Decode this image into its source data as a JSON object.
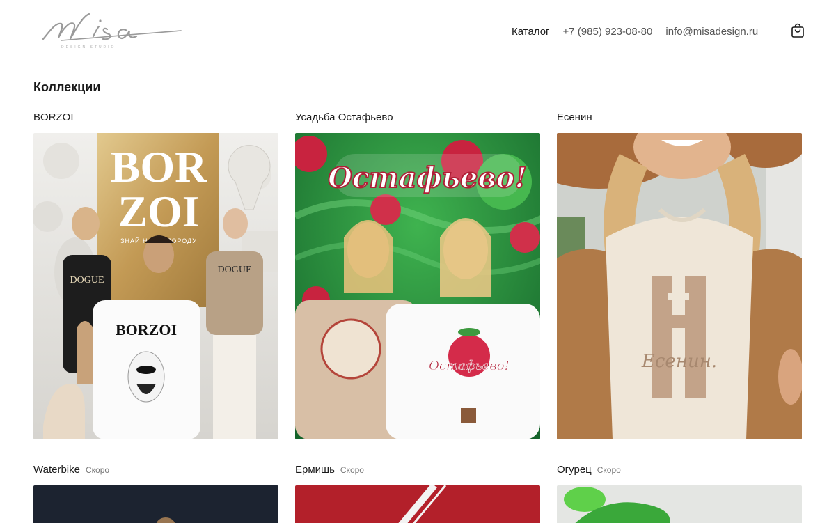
{
  "header": {
    "logo": {
      "text": "Misa",
      "subtext": "DESIGN STUDIO"
    },
    "nav": {
      "catalog": "Каталог",
      "phone": "+7 (985) 923-08-80",
      "email": "info@misadesign.ru"
    },
    "cart_icon": "shopping-bag-icon"
  },
  "main": {
    "title": "Коллекции",
    "collections": [
      {
        "name": "BORZOI",
        "badge": ""
      },
      {
        "name": "Усадьба Остафьево",
        "badge": ""
      },
      {
        "name": "Есенин",
        "badge": ""
      },
      {
        "name": "Waterbike",
        "badge": "Скоро"
      },
      {
        "name": "Ермишь",
        "badge": "Скоро"
      },
      {
        "name": "Огурец",
        "badge": "Скоро"
      }
    ]
  },
  "images": {
    "borzoi": {
      "headline": "BOR ZOI",
      "sub": "ЗНАЙ НАШУ ПОРОДУ",
      "shirt": "BORZOI",
      "tag": "DOGUE"
    },
    "ostafyevo": {
      "script": "Остафьево!"
    },
    "esenin": {
      "signature": "Есенин."
    }
  },
  "colors": {
    "text": "#1a1a1a",
    "muted": "#777777",
    "raspberry": "#c8233f",
    "green": "#2d8b3a",
    "gold": "#b8904a",
    "beige": "#d8bfa6"
  }
}
